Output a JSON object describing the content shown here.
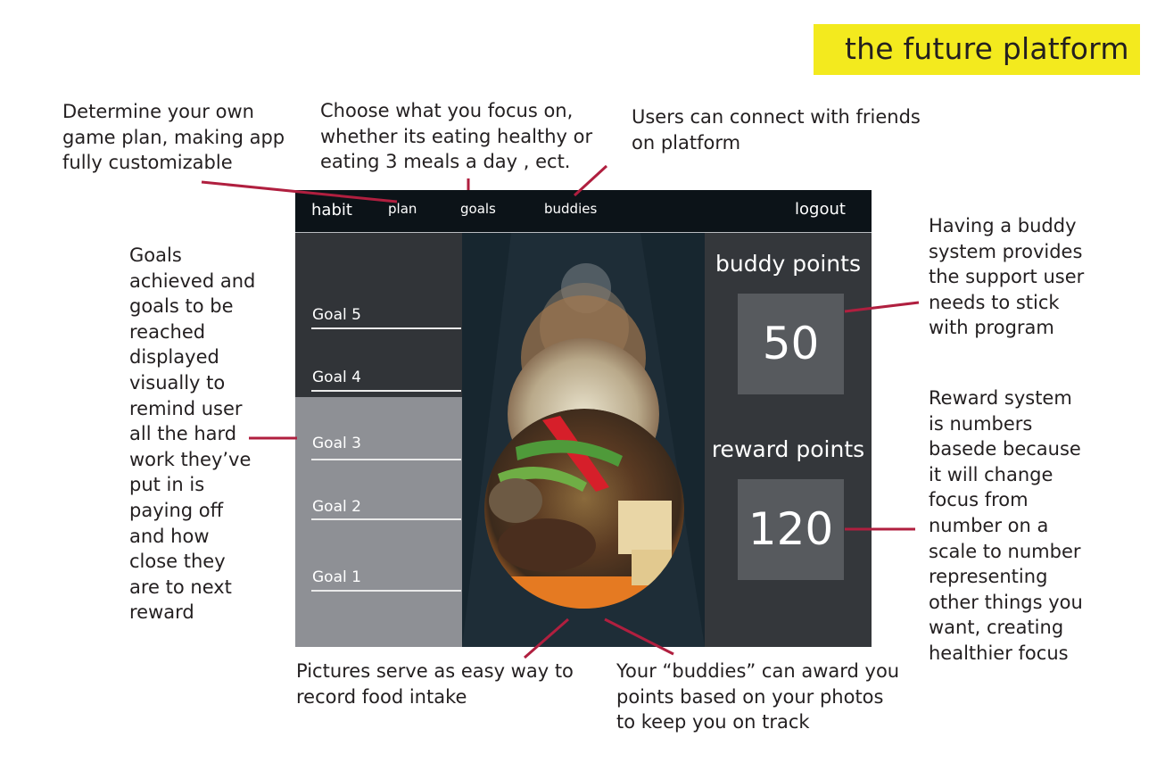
{
  "title": "the future platform",
  "annotations": {
    "plan": "Determine your own\ngame plan, making app\nfully customizable",
    "goals": "Choose what you focus on,\nwhether its eating healthy or\neating 3 meals a day , ect.",
    "buddies": "Users can connect with friends\non platform",
    "goal_list": "Goals\nachieved and\ngoals to be\nreached\ndisplayed\nvisually to\nremind user\nall the hard\nwork they’ve\nput in is\npaying off\nand how\nclose they\nare to next\nreward",
    "buddy_system": "Having a buddy\nsystem provides\nthe support user\nneeds to stick\nwith program",
    "reward_system": "Reward system\nis numbers\nbasede because\nit will change\nfocus from\nnumber on a\nscale to number\nrepresenting\nother things you\nwant, creating\nhealthier focus",
    "pictures": "Pictures serve as easy way to\nrecord food intake",
    "buddy_award": "Your “buddies” can award you\npoints based on your photos\nto keep you on track"
  },
  "app": {
    "brand": "habit",
    "nav": {
      "plan": "plan",
      "goals": "goals",
      "buddies": "buddies",
      "logout": "logout"
    },
    "goals": [
      "Goal 5",
      "Goal 4",
      "Goal 3",
      "Goal 2",
      "Goal 1"
    ],
    "buddy_points_label": "buddy points",
    "buddy_points_value": "50",
    "reward_points_label": "reward points",
    "reward_points_value": "120"
  },
  "colors": {
    "title_highlight": "#f3ea1e",
    "leader_line": "#b01f3f",
    "app_topbar": "#0c1318",
    "goals_achieved_panel": "#313438",
    "goals_pending_panel": "#8e9095"
  }
}
